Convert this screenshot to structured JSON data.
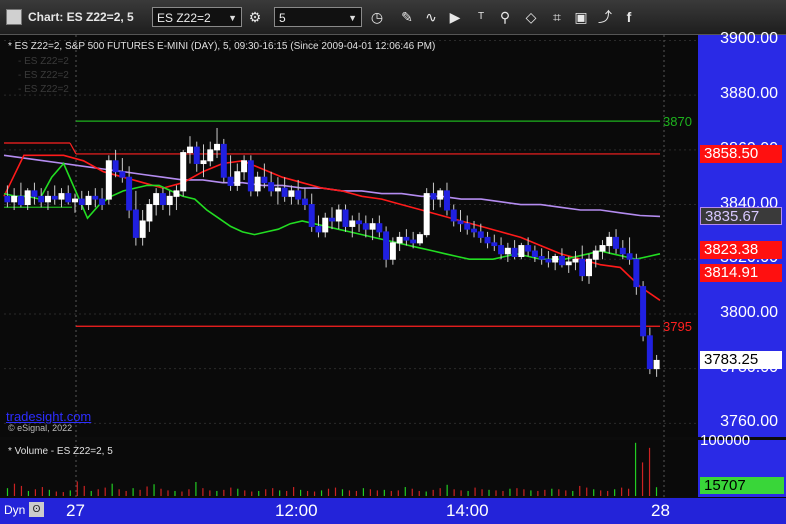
{
  "window": {
    "title": "Chart: ES Z22=2, 5"
  },
  "toolbar": {
    "symbol_value": "ES Z22=2",
    "interval_value": "5",
    "icons": [
      "settings-gear-icon",
      "clock-icon",
      "pencil-icon",
      "chart-icon",
      "play-icon",
      "text-icon",
      "pin-icon",
      "eraser-icon",
      "bookmark-icon",
      "share-icon",
      "facebook-icon"
    ]
  },
  "price_panel": {
    "legend": "* ES Z22=2, S&P 500 FUTURES E-MINI (DAY), 5, 09:30-16:15 (Since 2009-04-01 12:06:46 PM)",
    "ghost_legend": [
      "- ES Z22=2",
      "- ES Z22=2",
      "- ES Z22=2"
    ],
    "watermark": "tradesight.com",
    "copyright": "© eSignal, 2022"
  },
  "volume_panel": {
    "legend": "* Volume - ES Z22=2, 5",
    "axis_top": "100000",
    "last_volume": "15707"
  },
  "bottom_bar": {
    "dyn_label": "Dyn",
    "x_labels": [
      "27",
      "12:00",
      "14:00",
      "28"
    ]
  },
  "chart_data": {
    "type": "candlestick",
    "title": "ES Z22=2, S&P 500 FUTURES E-MINI (DAY), 5",
    "y_ticks": [
      "3900.00",
      "3880.00",
      "3860.00",
      "3840.00",
      "3820.00",
      "3800.00",
      "3780.00",
      "3760.00"
    ],
    "ylim": [
      3755,
      3902
    ],
    "price_tags": [
      {
        "label": "3858.50",
        "value": 3858.5,
        "style": "red"
      },
      {
        "label": "3835.67",
        "value": 3835.67,
        "style": "purple"
      },
      {
        "label": "3823.38",
        "value": 3823.38,
        "style": "red"
      },
      {
        "label": "3814.91",
        "value": 3814.91,
        "style": "red"
      },
      {
        "label": "3783.25",
        "value": 3783.25,
        "style": "white"
      }
    ],
    "levels": [
      {
        "label": "3870",
        "value": 3870.5,
        "color": "#1db31d"
      },
      {
        "label": "",
        "value": 3858.5,
        "color": "#ff2020"
      },
      {
        "label": "3795",
        "value": 3795.5,
        "color": "#ff2020"
      }
    ],
    "candles": [
      {
        "o": 3843,
        "h": 3847,
        "l": 3839,
        "c": 3841
      },
      {
        "o": 3841,
        "h": 3846,
        "l": 3838,
        "c": 3843
      },
      {
        "o": 3843,
        "h": 3848,
        "l": 3839,
        "c": 3840
      },
      {
        "o": 3840,
        "h": 3846,
        "l": 3838,
        "c": 3845
      },
      {
        "o": 3845,
        "h": 3848,
        "l": 3840,
        "c": 3843
      },
      {
        "o": 3843,
        "h": 3846,
        "l": 3839,
        "c": 3841
      },
      {
        "o": 3841,
        "h": 3845,
        "l": 3838,
        "c": 3843
      },
      {
        "o": 3843,
        "h": 3847,
        "l": 3840,
        "c": 3842
      },
      {
        "o": 3842,
        "h": 3846,
        "l": 3839,
        "c": 3844
      },
      {
        "o": 3844,
        "h": 3847,
        "l": 3840,
        "c": 3841
      },
      {
        "o": 3841,
        "h": 3844,
        "l": 3837,
        "c": 3842
      },
      {
        "o": 3842,
        "h": 3845,
        "l": 3838,
        "c": 3840
      },
      {
        "o": 3840,
        "h": 3845,
        "l": 3838,
        "c": 3843
      },
      {
        "o": 3843,
        "h": 3846,
        "l": 3839,
        "c": 3842
      },
      {
        "o": 3842,
        "h": 3846,
        "l": 3838,
        "c": 3840
      },
      {
        "o": 3842,
        "h": 3858,
        "l": 3840,
        "c": 3856
      },
      {
        "o": 3856,
        "h": 3860,
        "l": 3850,
        "c": 3852
      },
      {
        "o": 3852,
        "h": 3857,
        "l": 3848,
        "c": 3850
      },
      {
        "o": 3850,
        "h": 3854,
        "l": 3835,
        "c": 3838
      },
      {
        "o": 3838,
        "h": 3845,
        "l": 3825,
        "c": 3828
      },
      {
        "o": 3828,
        "h": 3838,
        "l": 3825,
        "c": 3834
      },
      {
        "o": 3834,
        "h": 3842,
        "l": 3830,
        "c": 3840
      },
      {
        "o": 3840,
        "h": 3846,
        "l": 3836,
        "c": 3844
      },
      {
        "o": 3844,
        "h": 3846,
        "l": 3838,
        "c": 3840
      },
      {
        "o": 3840,
        "h": 3845,
        "l": 3836,
        "c": 3843
      },
      {
        "o": 3843,
        "h": 3847,
        "l": 3838,
        "c": 3845
      },
      {
        "o": 3845,
        "h": 3860,
        "l": 3843,
        "c": 3859
      },
      {
        "o": 3859,
        "h": 3865,
        "l": 3855,
        "c": 3861
      },
      {
        "o": 3861,
        "h": 3863,
        "l": 3852,
        "c": 3855
      },
      {
        "o": 3855,
        "h": 3862,
        "l": 3850,
        "c": 3856
      },
      {
        "o": 3856,
        "h": 3863,
        "l": 3854,
        "c": 3860
      },
      {
        "o": 3860,
        "h": 3868,
        "l": 3857,
        "c": 3862
      },
      {
        "o": 3862,
        "h": 3864,
        "l": 3848,
        "c": 3850
      },
      {
        "o": 3850,
        "h": 3858,
        "l": 3845,
        "c": 3847
      },
      {
        "o": 3847,
        "h": 3855,
        "l": 3845,
        "c": 3852
      },
      {
        "o": 3852,
        "h": 3858,
        "l": 3849,
        "c": 3856
      },
      {
        "o": 3856,
        "h": 3858,
        "l": 3843,
        "c": 3845
      },
      {
        "o": 3845,
        "h": 3852,
        "l": 3843,
        "c": 3850
      },
      {
        "o": 3850,
        "h": 3855,
        "l": 3846,
        "c": 3848
      },
      {
        "o": 3848,
        "h": 3852,
        "l": 3843,
        "c": 3845
      },
      {
        "o": 3845,
        "h": 3850,
        "l": 3840,
        "c": 3846
      },
      {
        "o": 3846,
        "h": 3850,
        "l": 3841,
        "c": 3843
      },
      {
        "o": 3843,
        "h": 3847,
        "l": 3840,
        "c": 3845
      },
      {
        "o": 3845,
        "h": 3849,
        "l": 3840,
        "c": 3842
      },
      {
        "o": 3842,
        "h": 3846,
        "l": 3838,
        "c": 3840
      },
      {
        "o": 3840,
        "h": 3844,
        "l": 3830,
        "c": 3832
      },
      {
        "o": 3832,
        "h": 3836,
        "l": 3828,
        "c": 3830
      },
      {
        "o": 3830,
        "h": 3837,
        "l": 3828,
        "c": 3835
      },
      {
        "o": 3835,
        "h": 3839,
        "l": 3831,
        "c": 3834
      },
      {
        "o": 3834,
        "h": 3840,
        "l": 3831,
        "c": 3838
      },
      {
        "o": 3838,
        "h": 3840,
        "l": 3830,
        "c": 3832
      },
      {
        "o": 3832,
        "h": 3836,
        "l": 3828,
        "c": 3834
      },
      {
        "o": 3834,
        "h": 3837,
        "l": 3830,
        "c": 3833
      },
      {
        "o": 3833,
        "h": 3836,
        "l": 3828,
        "c": 3831
      },
      {
        "o": 3831,
        "h": 3835,
        "l": 3827,
        "c": 3833
      },
      {
        "o": 3833,
        "h": 3836,
        "l": 3828,
        "c": 3830
      },
      {
        "o": 3830,
        "h": 3832,
        "l": 3817,
        "c": 3820
      },
      {
        "o": 3820,
        "h": 3828,
        "l": 3818,
        "c": 3826
      },
      {
        "o": 3826,
        "h": 3830,
        "l": 3823,
        "c": 3828
      },
      {
        "o": 3828,
        "h": 3831,
        "l": 3825,
        "c": 3827
      },
      {
        "o": 3827,
        "h": 3830,
        "l": 3824,
        "c": 3826
      },
      {
        "o": 3826,
        "h": 3830,
        "l": 3825,
        "c": 3829
      },
      {
        "o": 3829,
        "h": 3846,
        "l": 3828,
        "c": 3844
      },
      {
        "o": 3844,
        "h": 3848,
        "l": 3838,
        "c": 3842
      },
      {
        "o": 3842,
        "h": 3846,
        "l": 3839,
        "c": 3845
      },
      {
        "o": 3845,
        "h": 3848,
        "l": 3836,
        "c": 3838
      },
      {
        "o": 3838,
        "h": 3840,
        "l": 3832,
        "c": 3834
      },
      {
        "o": 3834,
        "h": 3838,
        "l": 3830,
        "c": 3833
      },
      {
        "o": 3833,
        "h": 3836,
        "l": 3829,
        "c": 3831
      },
      {
        "o": 3831,
        "h": 3834,
        "l": 3828,
        "c": 3830
      },
      {
        "o": 3830,
        "h": 3833,
        "l": 3826,
        "c": 3828
      },
      {
        "o": 3828,
        "h": 3830,
        "l": 3824,
        "c": 3826
      },
      {
        "o": 3826,
        "h": 3829,
        "l": 3823,
        "c": 3825
      },
      {
        "o": 3825,
        "h": 3828,
        "l": 3820,
        "c": 3822
      },
      {
        "o": 3822,
        "h": 3826,
        "l": 3819,
        "c": 3824
      },
      {
        "o": 3824,
        "h": 3827,
        "l": 3820,
        "c": 3821
      },
      {
        "o": 3821,
        "h": 3826,
        "l": 3820,
        "c": 3825
      },
      {
        "o": 3825,
        "h": 3828,
        "l": 3821,
        "c": 3823
      },
      {
        "o": 3823,
        "h": 3825,
        "l": 3819,
        "c": 3821
      },
      {
        "o": 3821,
        "h": 3824,
        "l": 3818,
        "c": 3820
      },
      {
        "o": 3820,
        "h": 3823,
        "l": 3817,
        "c": 3819
      },
      {
        "o": 3819,
        "h": 3822,
        "l": 3816,
        "c": 3821
      },
      {
        "o": 3821,
        "h": 3824,
        "l": 3817,
        "c": 3818
      },
      {
        "o": 3818,
        "h": 3821,
        "l": 3815,
        "c": 3819
      },
      {
        "o": 3819,
        "h": 3823,
        "l": 3816,
        "c": 3820
      },
      {
        "o": 3820,
        "h": 3825,
        "l": 3812,
        "c": 3814
      },
      {
        "o": 3814,
        "h": 3822,
        "l": 3811,
        "c": 3820
      },
      {
        "o": 3820,
        "h": 3825,
        "l": 3817,
        "c": 3823
      },
      {
        "o": 3823,
        "h": 3827,
        "l": 3820,
        "c": 3825
      },
      {
        "o": 3825,
        "h": 3830,
        "l": 3822,
        "c": 3828
      },
      {
        "o": 3828,
        "h": 3831,
        "l": 3822,
        "c": 3824
      },
      {
        "o": 3824,
        "h": 3827,
        "l": 3820,
        "c": 3822
      },
      {
        "o": 3822,
        "h": 3828,
        "l": 3818,
        "c": 3820
      },
      {
        "o": 3820,
        "h": 3822,
        "l": 3807,
        "c": 3810
      },
      {
        "o": 3810,
        "h": 3812,
        "l": 3790,
        "c": 3792
      },
      {
        "o": 3792,
        "h": 3795,
        "l": 3778,
        "c": 3780
      },
      {
        "o": 3780,
        "h": 3785,
        "l": 3777,
        "c": 3783
      }
    ],
    "ema_red": [
      3843,
      3858,
      3858,
      3858,
      3856,
      3852,
      3850,
      3848,
      3846,
      3848,
      3852,
      3855,
      3856,
      3853,
      3850,
      3848,
      3846,
      3845,
      3843,
      3842,
      3840,
      3838,
      3836,
      3834,
      3832,
      3830,
      3828,
      3825,
      3822,
      3820,
      3818,
      3817,
      3810,
      3805
    ],
    "sma_purple": [
      3858,
      3857,
      3856,
      3855,
      3854,
      3853,
      3852,
      3851,
      3850,
      3849,
      3849,
      3848,
      3848,
      3847,
      3847,
      3846,
      3846,
      3845,
      3845,
      3844,
      3844,
      3843,
      3843,
      3842,
      3842,
      3841,
      3840,
      3840,
      3839,
      3838,
      3838,
      3837,
      3836,
      3835.67
    ],
    "green_line": [
      3844,
      3843,
      3843,
      3842,
      3850,
      3855,
      3845,
      3835,
      3840,
      3843,
      3845,
      3846,
      3847,
      3847,
      3845,
      3843,
      3842,
      3838,
      3835,
      3832,
      3830,
      3829,
      3830,
      3831,
      3833,
      3834,
      3833,
      3832,
      3831,
      3830,
      3829,
      3828,
      3827,
      3826,
      3825,
      3824,
      3823,
      3822,
      3821,
      3820,
      3820,
      3820,
      3821,
      3822,
      3821,
      3820,
      3820,
      3820,
      3821,
      3822,
      3823,
      3822,
      3821,
      3820,
      3821,
      3822
    ],
    "volume": [
      14000,
      22000,
      18000,
      9000,
      12000,
      16000,
      11000,
      8000,
      7000,
      10000,
      26000,
      18000,
      9000,
      12000,
      15000,
      22000,
      12000,
      9000,
      14000,
      11000,
      17000,
      21000,
      13000,
      10000,
      9000,
      8000,
      12000,
      25000,
      14000,
      10000,
      9000,
      11000,
      15000,
      13000,
      10000,
      8000,
      9000,
      12000,
      14000,
      10000,
      9000,
      16000,
      11000,
      9000,
      8000,
      10000,
      13000,
      15000,
      12000,
      10000,
      9000,
      14000,
      12000,
      10000,
      11000,
      9000,
      10000,
      16000,
      13000,
      9000,
      8000,
      11000,
      14000,
      20000,
      12000,
      10000,
      9000,
      15000,
      12000,
      11000,
      10000,
      9000,
      13000,
      14000,
      12000,
      10000,
      9000,
      11000,
      13000,
      12000,
      10000,
      9000,
      18000,
      15000,
      12000,
      10000,
      9000,
      12000,
      15000,
      13000,
      95000,
      60000,
      86000,
      15707
    ]
  }
}
